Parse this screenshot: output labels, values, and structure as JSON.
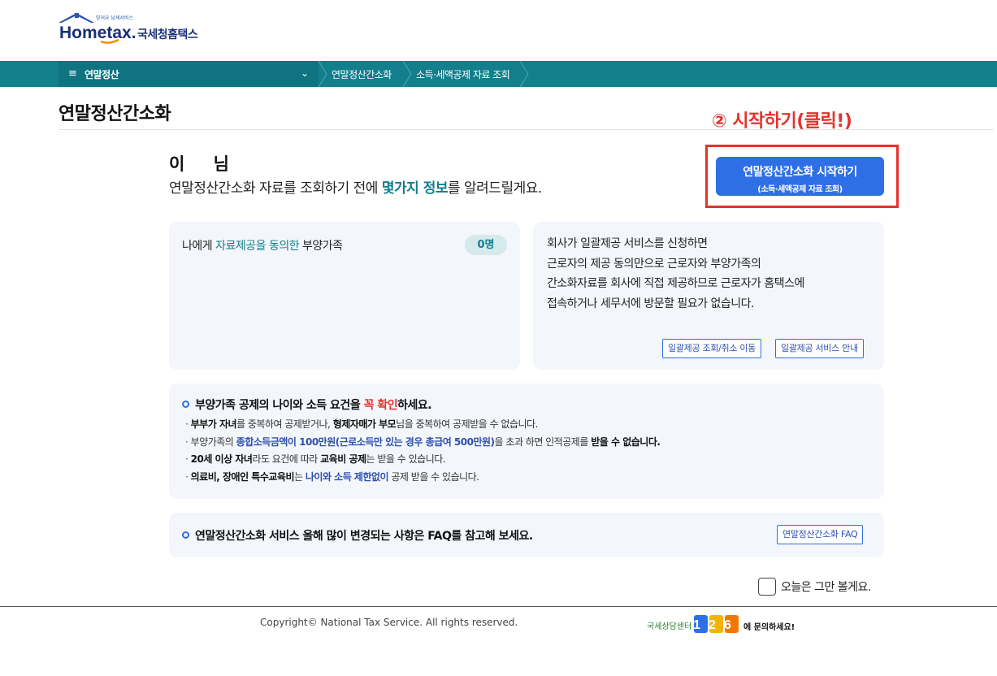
{
  "header": {
    "logo_tagline": "믿어요 납세서비스",
    "logo_text": "Hometax.",
    "logo_kr": "국세청홈택스"
  },
  "nav": {
    "menu_title": "연말정산",
    "breadcrumbs": [
      "연말정산간소화",
      "소득·세액공제 자료 조회"
    ]
  },
  "page": {
    "title": "연말정산간소화",
    "annotation": "② 시작하기(클릭!)",
    "start_button": {
      "line1": "연말정산간소화 시작하기",
      "line2": "(소득·세액공제 자료 조회)"
    },
    "greeting": "이 님",
    "intro_pre": "연말정산간소화 자료를 조회하기 전에 ",
    "intro_hl": "몇가지 정보",
    "intro_post": "를 알려드릴게요."
  },
  "dependents": {
    "label_pre": "나에게 ",
    "label_hl": "자료제공을 동의한",
    "label_post": " 부양가족",
    "count": "0명"
  },
  "bulk": {
    "lines": [
      "회사가 일괄제공 서비스를 신청하면",
      "근로자의 제공 동의만으로 근로자와 부양가족의",
      "간소화자료를 회사에 직접 제공하므로 근로자가 홈택스에",
      "접속하거나 세무서에 방문할 필요가 없습니다."
    ],
    "btn_query": "일괄제공 조회/취소 이동",
    "btn_guide": "일괄제공 서비스 안내"
  },
  "notice": {
    "head_pre": "부양가족 공제의 나이와 소득 요건을 ",
    "head_hl": "꼭 확인",
    "head_post": "하세요.",
    "item1_b1": "부부가 자녀",
    "item1_t1": "를 중복하여 공제받거나, ",
    "item1_b2": "형제자매가 부모",
    "item1_t2": "님을 중복하여 공제받을 수 없습니다.",
    "item2_t1": "부양가족의 ",
    "item2_bl": "종합소득금액이 100만원(근로소득만 있는 경우 총급여 500만원)",
    "item2_t2": "을 초과 하면 인적공제를 ",
    "item2_b": "받을 수 없습니다.",
    "item3_b1": "20세 이상 자녀",
    "item3_t1": "라도 요건에 따라 ",
    "item3_b2": "교육비 공제",
    "item3_t2": "는 받을 수 있습니다.",
    "item4_b": "의료비, 장애인 특수교육비",
    "item4_t1": "는 ",
    "item4_bl": "나이와 소득 제한없이",
    "item4_t2": " 공제 받을 수 있습니다."
  },
  "faq": {
    "text": "연말정산간소화 서비스 올해 많이 변경되는 사항은 FAQ를 참고해 보세요.",
    "button": "연말정산간소화 FAQ"
  },
  "dont_show": "오늘은 그만 볼게요.",
  "footer": {
    "copyright": "Copyright© National Tax Service. All rights reserved.",
    "call_pre": "국세상담센터",
    "call_num": "126",
    "call_post": "에 문의하세요!"
  },
  "colors": {
    "teal": "#137e8c",
    "blue": "#2e6fe6",
    "red": "#e5322b"
  }
}
